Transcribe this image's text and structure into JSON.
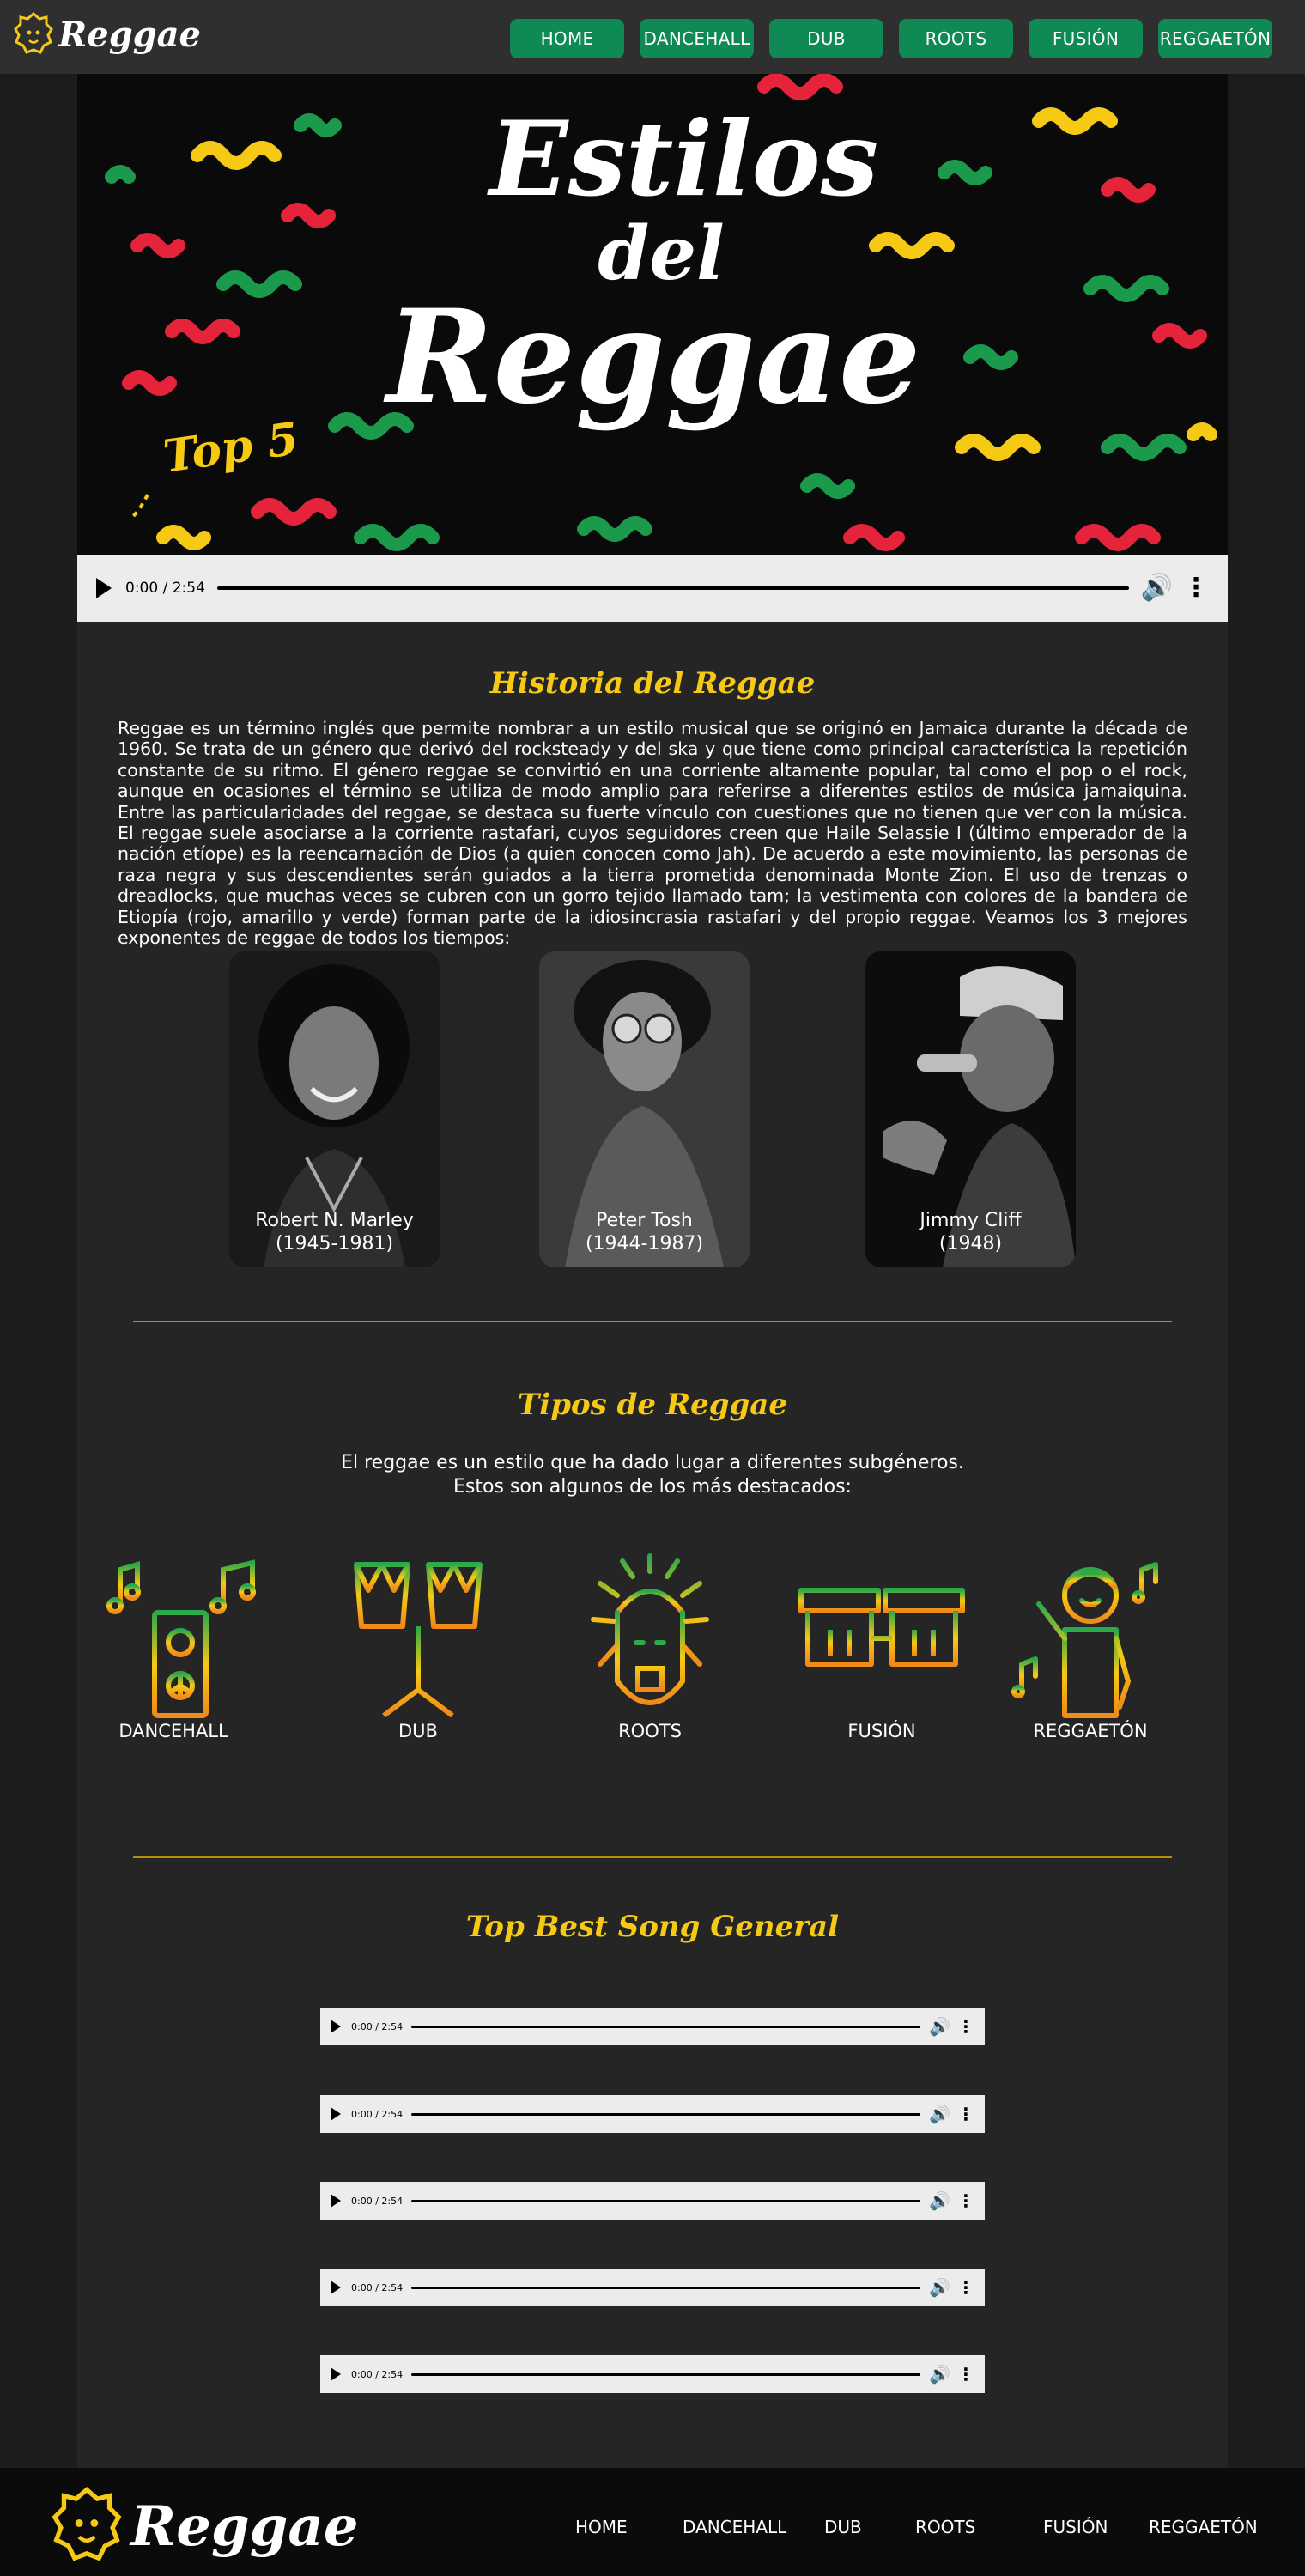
{
  "header": {
    "logo_text": "Reggae",
    "nav": [
      "HOME",
      "DANCEHALL",
      "DUB",
      "ROOTS",
      "FUSIÓN",
      "REGGAETÓN"
    ]
  },
  "hero": {
    "title_line1": "Estilos",
    "title_line2": "del",
    "title_line3": "Reggae",
    "badge": "Top 5",
    "audio_time": "0:00 / 2:54"
  },
  "history": {
    "title": "Historia del Reggae",
    "text": "Reggae es un término inglés que permite nombrar a un estilo musical que se originó en Jamaica durante la década de 1960. Se trata de un género que derivó del rocksteady y del ska y que tiene como principal característica la repetición constante de su ritmo. El género reggae se convirtió en una corriente altamente popular, tal como el pop o el rock, aunque en ocasiones el término se utiliza de modo amplio para referirse a diferentes estilos de música jamaiquina. Entre las particularidades del reggae, se destaca su fuerte vínculo con cuestiones que no tienen que ver con la música. El reggae suele asociarse a la corriente rastafari, cuyos seguidores creen que Haile Selassie I (último emperador de la nación etíope) es la reencarnación de Dios (a quien conocen como Jah). De acuerdo a este movimiento, las personas de raza negra y sus descendientes serán guiados a la tierra prometida denominada Monte Zion. El uso de trenzas o dreadlocks, que muchas veces se cubren con un gorro tejido llamado tam; la vestimenta con colores de la bandera de Etiopía (rojo, amarillo y verde) forman parte de la idiosincrasia rastafari y del propio reggae. Veamos los 3 mejores exponentes de reggae de todos los tiempos:",
    "artists": [
      {
        "name": "Robert N. Marley",
        "years": "(1945-1981)"
      },
      {
        "name": "Peter Tosh",
        "years": "(1944-1987)"
      },
      {
        "name": "Jimmy Cliff",
        "years": "(1948)"
      }
    ]
  },
  "types": {
    "title": "Tipos de Reggae",
    "text": "El reggae es un estilo que ha dado lugar a diferentes subgéneros. Estos son algunos de los más destacados:",
    "items": [
      {
        "label": "DANCEHALL",
        "icon": "speaker-music-icon"
      },
      {
        "label": "DUB",
        "icon": "bongo-drums-icon"
      },
      {
        "label": "ROOTS",
        "icon": "rasta-face-icon"
      },
      {
        "label": "FUSIÓN",
        "icon": "conga-drums-icon"
      },
      {
        "label": "REGGAETÓN",
        "icon": "dancer-icon"
      }
    ]
  },
  "songs": {
    "title": "Top Best Song General",
    "players": [
      "0:00 / 2:54",
      "0:00 / 2:54",
      "0:00 / 2:54",
      "0:00 / 2:54",
      "0:00 / 2:54"
    ]
  },
  "footer": {
    "logo_text": "Reggae",
    "nav": [
      "HOME",
      "DANCEHALL",
      "DUB",
      "ROOTS",
      "FUSIÓN",
      "REGGAETÓN"
    ]
  },
  "colors": {
    "green": "#0f8a55",
    "yellow": "#f6c915",
    "red": "#e5233a"
  }
}
